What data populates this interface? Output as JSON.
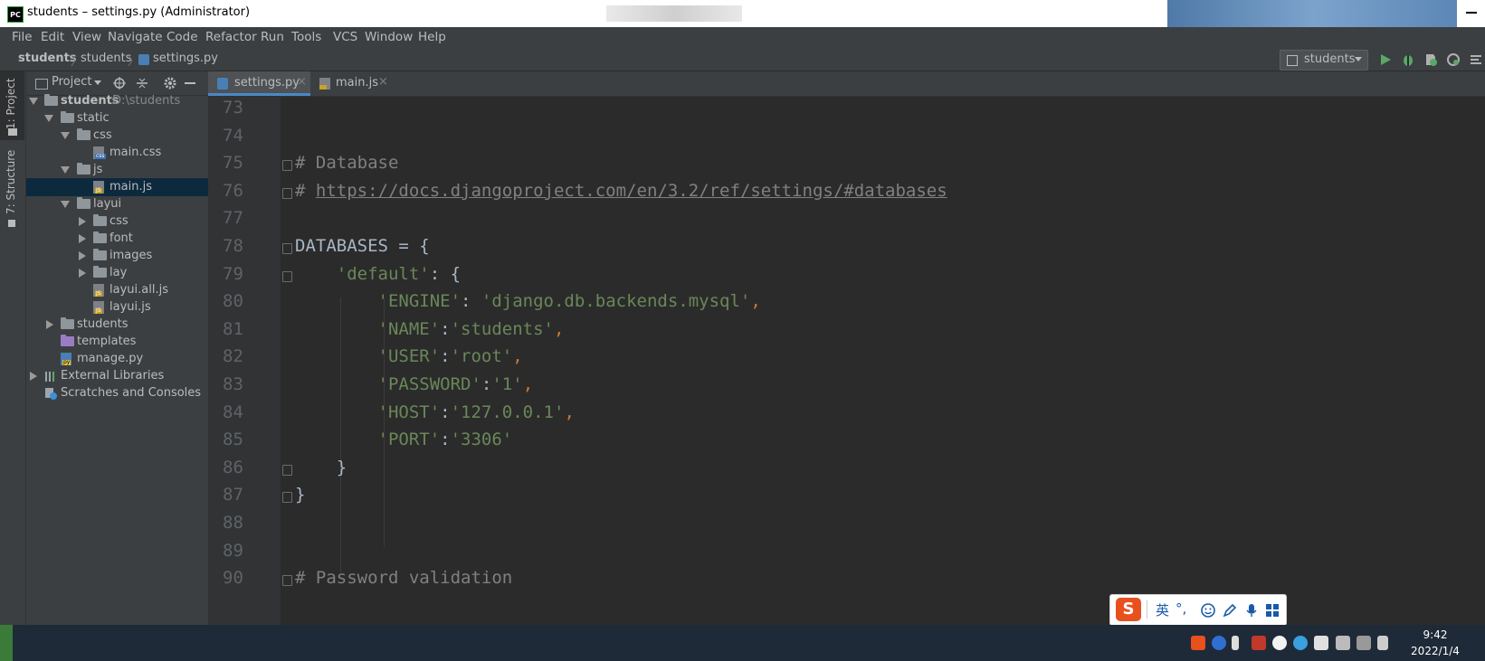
{
  "window": {
    "app_icon": "PC",
    "title": "students – settings.py (Administrator)"
  },
  "menu": [
    "File",
    "Edit",
    "View",
    "Navigate",
    "Code",
    "Refactor",
    "Run",
    "Tools",
    "VCS",
    "Window",
    "Help"
  ],
  "breadcrumb": [
    "students",
    "students",
    "settings.py"
  ],
  "run_config": "students",
  "side_tabs": [
    "1: Project",
    "7: Structure"
  ],
  "project_panel": {
    "title": "Project",
    "tree": [
      {
        "label": "students",
        "path": "D:\\students",
        "level": 0,
        "type": "folder",
        "expanded": true,
        "bold": true
      },
      {
        "label": "static",
        "level": 1,
        "type": "folder",
        "expanded": true
      },
      {
        "label": "css",
        "level": 2,
        "type": "folder",
        "expanded": true
      },
      {
        "label": "main.css",
        "level": 3,
        "type": "css-file"
      },
      {
        "label": "js",
        "level": 2,
        "type": "folder",
        "expanded": true
      },
      {
        "label": "main.js",
        "level": 3,
        "type": "js-file",
        "selected": true
      },
      {
        "label": "layui",
        "level": 2,
        "type": "folder",
        "expanded": true
      },
      {
        "label": "css",
        "level": 3,
        "type": "folder",
        "expanded": false
      },
      {
        "label": "font",
        "level": 3,
        "type": "folder",
        "expanded": false
      },
      {
        "label": "images",
        "level": 3,
        "type": "folder",
        "expanded": false
      },
      {
        "label": "lay",
        "level": 3,
        "type": "folder",
        "expanded": false
      },
      {
        "label": "layui.all.js",
        "level": 3,
        "type": "js-file"
      },
      {
        "label": "layui.js",
        "level": 3,
        "type": "js-file"
      },
      {
        "label": "students",
        "level": 1,
        "type": "folder",
        "expanded": false
      },
      {
        "label": "templates",
        "level": 1,
        "type": "purple-folder"
      },
      {
        "label": "manage.py",
        "level": 1,
        "type": "py-file"
      },
      {
        "label": "External Libraries",
        "level": 0,
        "type": "library",
        "expanded": false
      },
      {
        "label": "Scratches and Consoles",
        "level": 0,
        "type": "scratch"
      }
    ]
  },
  "tabs": [
    {
      "label": "settings.py",
      "active": true
    },
    {
      "label": "main.js",
      "active": false
    }
  ],
  "code_lines": [
    {
      "num": "73",
      "segments": []
    },
    {
      "num": "74",
      "segments": []
    },
    {
      "num": "75",
      "segments": [
        {
          "t": "# Database",
          "c": "cmt"
        }
      ]
    },
    {
      "num": "76",
      "segments": [
        {
          "t": "# ",
          "c": "cmt"
        },
        {
          "t": "https://docs.djangoproject.com/en/3.2/ref/settings/#databases",
          "c": "url"
        }
      ]
    },
    {
      "num": "77",
      "segments": []
    },
    {
      "num": "78",
      "segments": [
        {
          "t": "DATABASES = {",
          "c": "plain"
        }
      ]
    },
    {
      "num": "79",
      "segments": [
        {
          "t": "    ",
          "c": "plain"
        },
        {
          "t": "'default'",
          "c": "str"
        },
        {
          "t": ": {",
          "c": "plain"
        }
      ]
    },
    {
      "num": "80",
      "segments": [
        {
          "t": "        ",
          "c": "plain"
        },
        {
          "t": "'ENGINE'",
          "c": "str"
        },
        {
          "t": ": ",
          "c": "plain"
        },
        {
          "t": "'django.db.backends.mysql'",
          "c": "str"
        },
        {
          "t": ",",
          "c": "kw"
        }
      ]
    },
    {
      "num": "81",
      "segments": [
        {
          "t": "        ",
          "c": "plain"
        },
        {
          "t": "'NAME'",
          "c": "str"
        },
        {
          "t": ":",
          "c": "plain"
        },
        {
          "t": "'students'",
          "c": "str"
        },
        {
          "t": ",",
          "c": "kw"
        }
      ]
    },
    {
      "num": "82",
      "segments": [
        {
          "t": "        ",
          "c": "plain"
        },
        {
          "t": "'USER'",
          "c": "str"
        },
        {
          "t": ":",
          "c": "plain"
        },
        {
          "t": "'root'",
          "c": "str"
        },
        {
          "t": ",",
          "c": "kw"
        }
      ]
    },
    {
      "num": "83",
      "segments": [
        {
          "t": "        ",
          "c": "plain"
        },
        {
          "t": "'PASSWORD'",
          "c": "str"
        },
        {
          "t": ":",
          "c": "plain"
        },
        {
          "t": "'1'",
          "c": "str"
        },
        {
          "t": ",",
          "c": "kw"
        }
      ]
    },
    {
      "num": "84",
      "segments": [
        {
          "t": "        ",
          "c": "plain"
        },
        {
          "t": "'HOST'",
          "c": "str"
        },
        {
          "t": ":",
          "c": "plain"
        },
        {
          "t": "'127.0.0.1'",
          "c": "str"
        },
        {
          "t": ",",
          "c": "kw"
        }
      ]
    },
    {
      "num": "85",
      "segments": [
        {
          "t": "        ",
          "c": "plain"
        },
        {
          "t": "'PORT'",
          "c": "str"
        },
        {
          "t": ":",
          "c": "plain"
        },
        {
          "t": "'3306'",
          "c": "str"
        }
      ]
    },
    {
      "num": "86",
      "segments": [
        {
          "t": "    }",
          "c": "plain"
        }
      ]
    },
    {
      "num": "87",
      "segments": [
        {
          "t": "}",
          "c": "plain"
        }
      ]
    },
    {
      "num": "88",
      "segments": []
    },
    {
      "num": "89",
      "segments": []
    },
    {
      "num": "90",
      "segments": [
        {
          "t": "# Password validation",
          "c": "cmt"
        }
      ]
    }
  ],
  "ime_bar": {
    "lang": "英",
    "punct": "°,"
  },
  "clock": {
    "time": "9:42",
    "date": "2022/1/4"
  },
  "colors": {
    "accent": "#4a88c7",
    "selection": "#0d293e",
    "string": "#6a8759",
    "comment": "#808080",
    "keyword": "#cc7832"
  }
}
